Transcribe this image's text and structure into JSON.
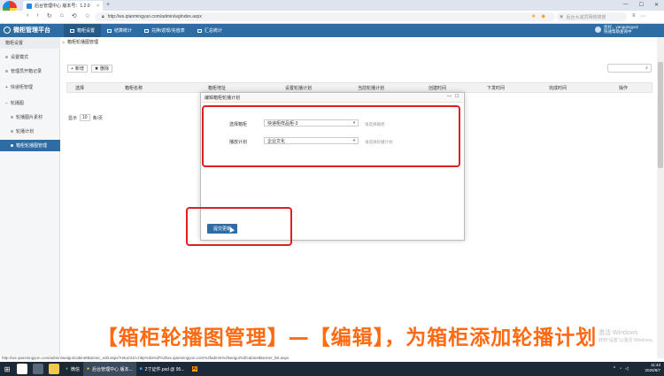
{
  "browser": {
    "tab_title": "后台管理中心 版本号：1.2.0",
    "url": "http://wx.qianmingyun.com/admin/wgIndex.aspx",
    "search_placeholder": "后台大减员网络搜搜"
  },
  "app": {
    "brand": "微柜管理平台",
    "nav": [
      "箱柜设置",
      "结算统计",
      "兑换/返现/充值表",
      "汇总统计"
    ],
    "user_line1": "您好，yangqingyu2",
    "user_line2": "快速帮助查询中"
  },
  "sidebar": {
    "header": "箱柜设置",
    "items": [
      "设置模式",
      "管理员开箱记录",
      "快递柜管理",
      "轮播图",
      "轮播图片素材",
      "轮播计划",
      "箱柜轮播图管理"
    ]
  },
  "main": {
    "breadcrumb": "箱柜轮播图管理",
    "add_button": "新增",
    "delete_button": "删除",
    "columns": [
      "选择",
      "箱柜名称",
      "箱柜地址",
      "设置轮播计划",
      "当前轮播计划",
      "创建时间",
      "下发时间",
      "完成时间",
      "操作"
    ],
    "pager_show": "显示",
    "pager_size": "10",
    "pager_unit": "条/页"
  },
  "modal": {
    "title": "编辑箱柜轮播计划",
    "label_box": "选择箱柜",
    "box_value": "快递柜样品柜-3",
    "box_hint": "请选择箱柜",
    "label_plan": "播放计划",
    "plan_value": "企业文化",
    "plan_hint": "请选择轮播计划",
    "submit": "提交更新"
  },
  "caption": "【箱柜轮播图管理】—【编辑】，为箱柜添加轮播计划",
  "watermark": [
    "激活 Windows",
    "转到\"设置\"以激活 Windows。"
  ],
  "status_url": "http://wx.qianmingyun.com/admin/weigui/cabinetBanner_edit.aspx?returnUrl=http%3a%2f%2fwx.qianmingyun.com%2fadmin%2fweigui%2fcabinetBanner_list.aspx",
  "taskbar": {
    "apps": [
      "微信",
      "后台管理中心 版本...",
      "2寸证件.psd @ 95...",
      "Ai"
    ],
    "time": "11:43",
    "date": "2020/8/7"
  },
  "colors": {
    "primary": "#2e6da4",
    "highlight": "#e02020",
    "caption": "#ff6a13"
  }
}
